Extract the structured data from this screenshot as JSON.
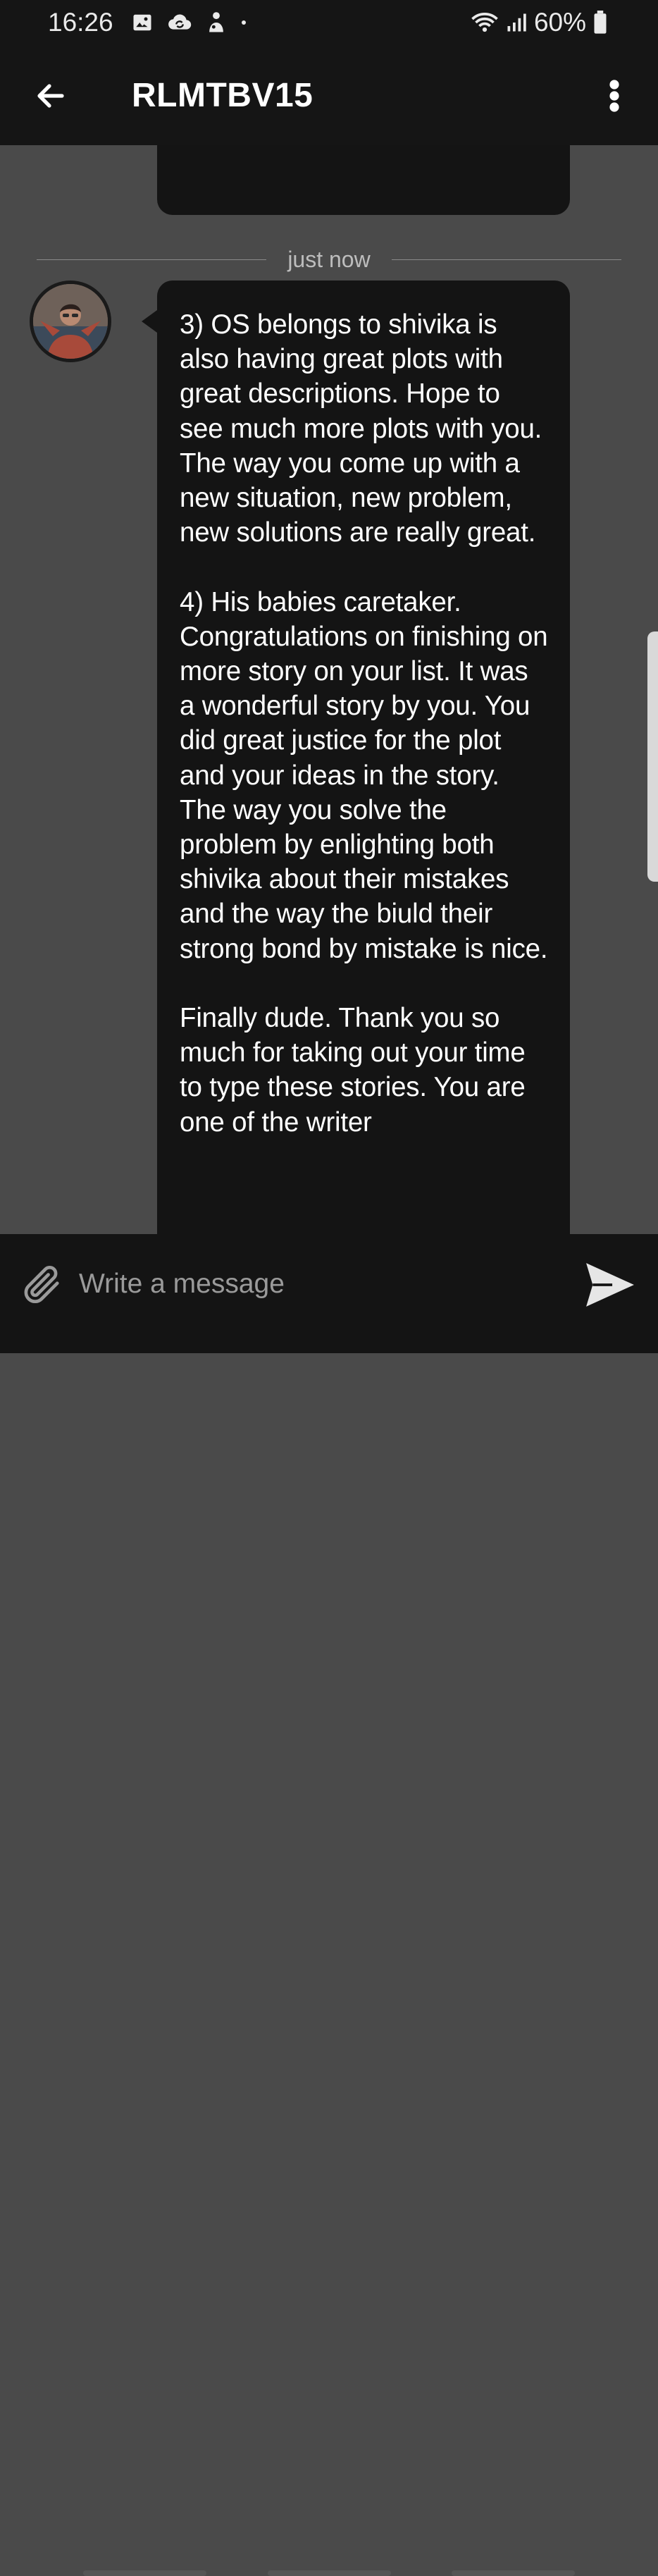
{
  "status_bar": {
    "time": "16:26",
    "battery": "60%",
    "icons": [
      "image-icon",
      "cloud-sync-icon",
      "notification-icon",
      "dot-icon",
      "wifi-icon",
      "signal-icon",
      "battery-icon"
    ]
  },
  "header": {
    "title": "RLMTBV15",
    "back_icon": "arrow-left-icon",
    "menu_icon": "more-vertical-icon"
  },
  "chat": {
    "divider_label": "just now",
    "message": {
      "sender_avatar": "avatar",
      "text": "3) OS belongs to shivika is also having great plots with great descriptions. Hope to see much more plots with you. The way you come up with a new situation, new problem, new solutions are really great.\n\n4) His babies caretaker. Congratulations on finishing on more story on your list. It was a wonderful story by you. You did great justice for the plot and your ideas in the story. The way you solve the problem by enlighting both shivika about their mistakes and the way the biuld their strong bond by mistake is nice.\n\nFinally dude. Thank you so much for taking out your time to type these stories. You are one of the writer"
    }
  },
  "composer": {
    "placeholder": "Write a message",
    "attach_icon": "paperclip-icon",
    "send_icon": "send-icon"
  },
  "colors": {
    "bar_bg": "#151515",
    "chat_bg": "#4a4a4a",
    "bubble_bg": "#141414",
    "text": "#ffffff",
    "muted": "#bdbdbd"
  }
}
